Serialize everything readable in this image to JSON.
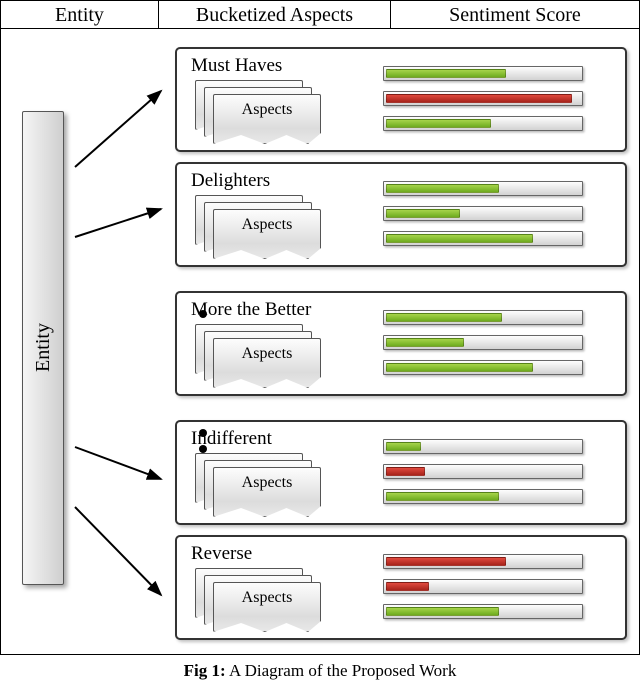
{
  "header": {
    "col1": "Entity",
    "col2": "Bucketized Aspects",
    "col3": "Sentiment Score"
  },
  "entity_label": "Entity",
  "aspects_card_label": "Aspects",
  "buckets": [
    {
      "title": "Must Haves",
      "bars": [
        {
          "color": "green",
          "pct": 62
        },
        {
          "color": "red",
          "pct": 96
        },
        {
          "color": "green",
          "pct": 54
        }
      ]
    },
    {
      "title": "Delighters",
      "bars": [
        {
          "color": "green",
          "pct": 58
        },
        {
          "color": "green",
          "pct": 38
        },
        {
          "color": "green",
          "pct": 76
        }
      ]
    },
    {
      "title": "More the Better",
      "bars": [
        {
          "color": "green",
          "pct": 60
        },
        {
          "color": "green",
          "pct": 40
        },
        {
          "color": "green",
          "pct": 76
        }
      ]
    },
    {
      "title": "Indifferent",
      "bars": [
        {
          "color": "green",
          "pct": 18
        },
        {
          "color": "red",
          "pct": 20
        },
        {
          "color": "green",
          "pct": 58
        }
      ]
    },
    {
      "title": "Reverse",
      "bars": [
        {
          "color": "red",
          "pct": 62
        },
        {
          "color": "red",
          "pct": 22
        },
        {
          "color": "green",
          "pct": 58
        }
      ]
    }
  ],
  "caption": {
    "label": "Fig 1:",
    "text": " A Diagram of the Proposed Work"
  }
}
